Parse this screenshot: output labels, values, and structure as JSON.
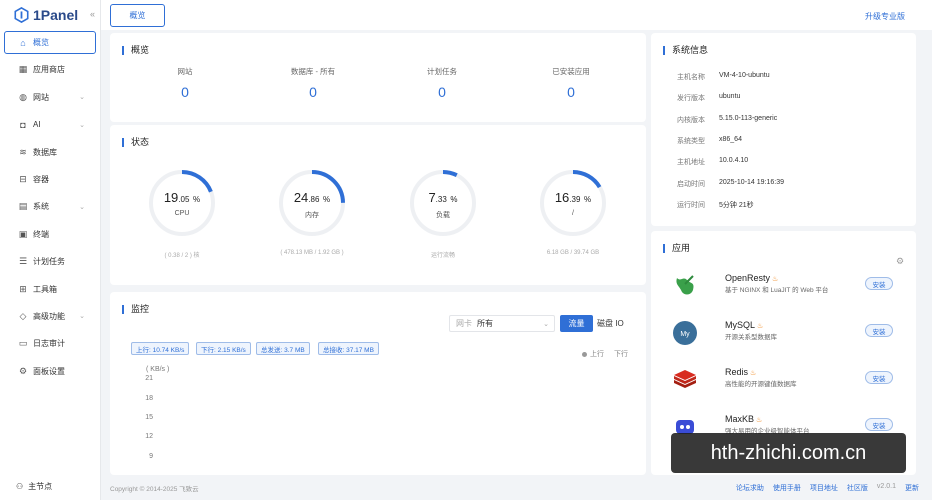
{
  "brand": {
    "name": "1Panel"
  },
  "sidebar": {
    "items": [
      {
        "label": "概览",
        "icon": "home-icon",
        "glyph": "⌂",
        "chevron": false
      },
      {
        "label": "应用商店",
        "icon": "grid-icon",
        "glyph": "▦",
        "chevron": false
      },
      {
        "label": "网站",
        "icon": "globe-icon",
        "glyph": "◍",
        "chevron": true
      },
      {
        "label": "AI",
        "icon": "robot-icon",
        "glyph": "◘",
        "chevron": true
      },
      {
        "label": "数据库",
        "icon": "layers-icon",
        "glyph": "≋",
        "chevron": false
      },
      {
        "label": "容器",
        "icon": "container-icon",
        "glyph": "⊟",
        "chevron": false
      },
      {
        "label": "系统",
        "icon": "system-icon",
        "glyph": "▤",
        "chevron": true
      },
      {
        "label": "终端",
        "icon": "terminal-icon",
        "glyph": "▣",
        "chevron": false
      },
      {
        "label": "计划任务",
        "icon": "task-icon",
        "glyph": "☰",
        "chevron": false
      },
      {
        "label": "工具箱",
        "icon": "toolbox-icon",
        "glyph": "⊞",
        "chevron": false
      },
      {
        "label": "高级功能",
        "icon": "diamond-icon",
        "glyph": "◇",
        "chevron": true
      },
      {
        "label": "日志审计",
        "icon": "log-icon",
        "glyph": "▭",
        "chevron": false
      },
      {
        "label": "面板设置",
        "icon": "settings-icon",
        "glyph": "⚙",
        "chevron": false
      }
    ],
    "footer": {
      "label": "主节点",
      "icon": "user-icon"
    }
  },
  "header": {
    "tab": "概览",
    "upgrade": "升级专业版"
  },
  "overview": {
    "title": "概览",
    "items": [
      {
        "label": "网站",
        "value": "0"
      },
      {
        "label": "数据库 - 所有",
        "value": "0"
      },
      {
        "label": "计划任务",
        "value": "0"
      },
      {
        "label": "已安装应用",
        "value": "0"
      }
    ]
  },
  "status": {
    "title": "状态",
    "gauges": [
      {
        "int": "19",
        "dec": ".05",
        "unit": "%",
        "label": "CPU",
        "footer": "( 0.38 / 2 ) 核",
        "percent": 19.05
      },
      {
        "int": "24",
        "dec": ".86",
        "unit": "%",
        "label": "内存",
        "footer": "( 478.13 MB / 1.92 GB )",
        "percent": 24.86
      },
      {
        "int": "7",
        "dec": ".33",
        "unit": "%",
        "label": "负载",
        "footer": "运行流畅",
        "percent": 7.33
      },
      {
        "int": "16",
        "dec": ".39",
        "unit": "%",
        "label": "/",
        "footer": "6.18 GB / 39.74 GB",
        "percent": 16.39
      }
    ]
  },
  "monitor": {
    "title": "监控",
    "select_prefix": "网卡",
    "select_value": "所有",
    "btn_flow": "流量",
    "btn_io": "磁盘 IO",
    "tags": [
      "上行: 10.74 KB/s",
      "下行: 2.15 KB/s",
      "总发送: 3.7 MB",
      "总接收: 37.17 MB"
    ],
    "legend": {
      "up": "上行",
      "down": "下行"
    },
    "unit": "( KB/s )",
    "ticks": [
      "21",
      "18",
      "15",
      "12",
      "9"
    ]
  },
  "sysinfo": {
    "title": "系统信息",
    "rows": [
      {
        "k": "主机名称",
        "v": "VM-4-10-ubuntu"
      },
      {
        "k": "发行版本",
        "v": "ubuntu"
      },
      {
        "k": "内核版本",
        "v": "5.15.0-113-generic"
      },
      {
        "k": "系统类型",
        "v": "x86_64"
      },
      {
        "k": "主机地址",
        "v": "10.0.4.10"
      },
      {
        "k": "启动时间",
        "v": "2025-10-14 19:16:39"
      },
      {
        "k": "运行时间",
        "v": "5分钟 21秒"
      }
    ]
  },
  "apps": {
    "title": "应用",
    "items": [
      {
        "name": "OpenResty",
        "desc": "基于 NGINX 和 LuaJIT 的 Web 平台",
        "btn": "安装",
        "icon": "openresty-icon",
        "color": "#ffffff"
      },
      {
        "name": "MySQL",
        "desc": "开源关系型数据库",
        "btn": "安装",
        "icon": "mysql-icon",
        "color": "#ffffff"
      },
      {
        "name": "Redis",
        "desc": "高性能的开源键值数据库",
        "btn": "安装",
        "icon": "redis-icon",
        "color": "#ffffff"
      },
      {
        "name": "MaxKB",
        "desc": "强大易用的企业级智能体平台",
        "btn": "安装",
        "icon": "maxkb-icon",
        "color": "#ffffff"
      }
    ]
  },
  "footer": {
    "copyright": "Copyright © 2014-2025 飞致云",
    "links": [
      "论坛求助",
      "使用手册",
      "项目地址",
      "社区版"
    ],
    "version": "v2.0.1",
    "update": "更新"
  },
  "watermark": "hth-zhichi.com.cn",
  "colors": {
    "accent": "#2f6fd6",
    "bg": "#f2f4f7"
  }
}
